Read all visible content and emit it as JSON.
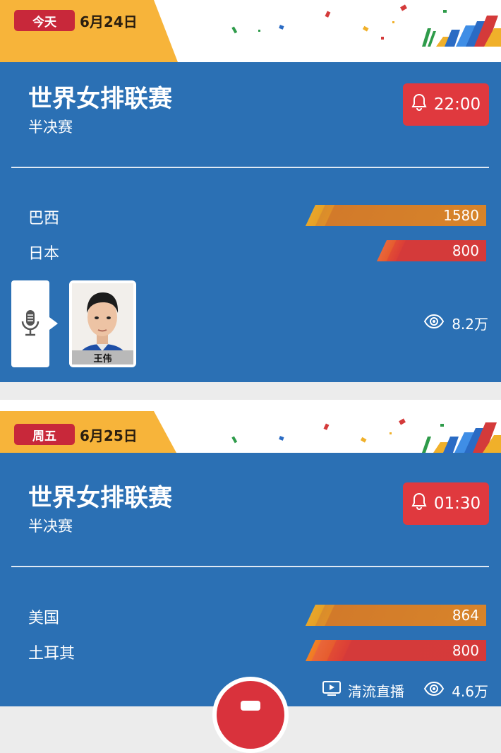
{
  "matches": [
    {
      "day_label": "今天",
      "date": "6月24日",
      "title": "世界女排联赛",
      "stage": "半决赛",
      "reminder_time": "22:00",
      "teams": [
        {
          "name": "巴西",
          "votes": "1580",
          "fraction": 1.0,
          "style": "orange"
        },
        {
          "name": "日本",
          "votes": "800",
          "fraction": 0.6,
          "style": "red"
        }
      ],
      "commentator": {
        "name": "王伟"
      },
      "views": "8.2万"
    },
    {
      "day_label": "周五",
      "date": "6月25日",
      "title": "世界女排联赛",
      "stage": "半决赛",
      "reminder_time": "01:30",
      "teams": [
        {
          "name": "美国",
          "votes": "864",
          "fraction": 1.0,
          "style": "orange"
        },
        {
          "name": "土耳其",
          "votes": "800",
          "fraction": 1.0,
          "style": "red"
        }
      ],
      "live_label": "清流直播",
      "views": "4.6万"
    }
  ],
  "colors": {
    "card": "#2b70b4",
    "banner": "#f7b43a",
    "day_pill": "#c8283a",
    "alarm": "#e0393e"
  },
  "icons": [
    "bell-icon",
    "eye-icon",
    "microphone-icon",
    "tv-play-icon"
  ]
}
